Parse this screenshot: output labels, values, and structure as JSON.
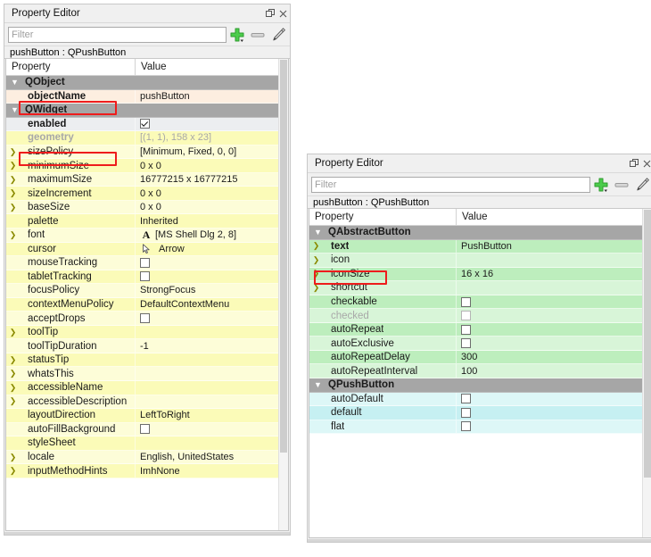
{
  "left_panel": {
    "title": "Property Editor",
    "window_controls": {
      "float_label": "float-icon",
      "close_label": "close-icon"
    },
    "filter": {
      "value": "",
      "placeholder": "Filter"
    },
    "toolbar": {
      "add_label": "add-icon",
      "remove_label": "remove-icon",
      "configure_label": "configure-icon"
    },
    "object_header": "pushButton : QPushButton",
    "columns": {
      "property": "Property",
      "value": "Value"
    },
    "rows": [
      {
        "kind": "group",
        "prop": "QObject",
        "value": "",
        "expander": "v",
        "tint": "group"
      },
      {
        "kind": "prop",
        "prop": "objectName",
        "value": "pushButton",
        "expander": "",
        "tint": "tint-peach",
        "bold": true
      },
      {
        "kind": "group",
        "prop": "QWidget",
        "value": "",
        "expander": "v",
        "tint": "group"
      },
      {
        "kind": "check",
        "prop": "enabled",
        "value": "checked",
        "expander": "",
        "tint": "tint-gray",
        "bold": true
      },
      {
        "kind": "prop",
        "prop": "geometry",
        "value": "[(1, 1), 158 x 23]",
        "expander": "",
        "tint": "tint-yel2",
        "bold": true,
        "disabled": true
      },
      {
        "kind": "prop",
        "prop": "sizePolicy",
        "value": "[Minimum, Fixed, 0, 0]",
        "expander": ">",
        "tint": "tint-yel1"
      },
      {
        "kind": "prop",
        "prop": "minimumSize",
        "value": "0 x 0",
        "expander": ">",
        "tint": "tint-yel2"
      },
      {
        "kind": "prop",
        "prop": "maximumSize",
        "value": "16777215 x 16777215",
        "expander": ">",
        "tint": "tint-yel1"
      },
      {
        "kind": "prop",
        "prop": "sizeIncrement",
        "value": "0 x 0",
        "expander": ">",
        "tint": "tint-yel2"
      },
      {
        "kind": "prop",
        "prop": "baseSize",
        "value": "0 x 0",
        "expander": ">",
        "tint": "tint-yel1"
      },
      {
        "kind": "prop",
        "prop": "palette",
        "value": "Inherited",
        "expander": "",
        "tint": "tint-yel2"
      },
      {
        "kind": "font",
        "prop": "font",
        "value": "[MS Shell Dlg 2, 8]",
        "expander": ">",
        "tint": "tint-yel1"
      },
      {
        "kind": "cursor",
        "prop": "cursor",
        "value": "Arrow",
        "expander": "",
        "tint": "tint-yel2"
      },
      {
        "kind": "check",
        "prop": "mouseTracking",
        "value": "unchecked",
        "expander": "",
        "tint": "tint-yel1"
      },
      {
        "kind": "check",
        "prop": "tabletTracking",
        "value": "unchecked",
        "expander": "",
        "tint": "tint-yel2"
      },
      {
        "kind": "prop",
        "prop": "focusPolicy",
        "value": "StrongFocus",
        "expander": "",
        "tint": "tint-yel1"
      },
      {
        "kind": "prop",
        "prop": "contextMenuPolicy",
        "value": "DefaultContextMenu",
        "expander": "",
        "tint": "tint-yel2"
      },
      {
        "kind": "check",
        "prop": "acceptDrops",
        "value": "unchecked",
        "expander": "",
        "tint": "tint-yel1"
      },
      {
        "kind": "prop",
        "prop": "toolTip",
        "value": "",
        "expander": ">",
        "tint": "tint-yel2"
      },
      {
        "kind": "prop",
        "prop": "toolTipDuration",
        "value": "-1",
        "expander": "",
        "tint": "tint-yel1"
      },
      {
        "kind": "prop",
        "prop": "statusTip",
        "value": "",
        "expander": ">",
        "tint": "tint-yel2"
      },
      {
        "kind": "prop",
        "prop": "whatsThis",
        "value": "",
        "expander": ">",
        "tint": "tint-yel1"
      },
      {
        "kind": "prop",
        "prop": "accessibleName",
        "value": "",
        "expander": ">",
        "tint": "tint-yel2"
      },
      {
        "kind": "prop",
        "prop": "accessibleDescription",
        "value": "",
        "expander": ">",
        "tint": "tint-yel1"
      },
      {
        "kind": "prop",
        "prop": "layoutDirection",
        "value": "LeftToRight",
        "expander": "",
        "tint": "tint-yel2"
      },
      {
        "kind": "check",
        "prop": "autoFillBackground",
        "value": "unchecked",
        "expander": "",
        "tint": "tint-yel1"
      },
      {
        "kind": "prop",
        "prop": "styleSheet",
        "value": "",
        "expander": "",
        "tint": "tint-yel2"
      },
      {
        "kind": "prop",
        "prop": "locale",
        "value": "English, UnitedStates",
        "expander": ">",
        "tint": "tint-yel1"
      },
      {
        "kind": "prop",
        "prop": "inputMethodHints",
        "value": "ImhNone",
        "expander": ">",
        "tint": "tint-yel2"
      }
    ]
  },
  "right_panel": {
    "title": "Property Editor",
    "window_controls": {
      "float_label": "float-icon",
      "close_label": "close-icon"
    },
    "filter": {
      "value": "",
      "placeholder": "Filter"
    },
    "toolbar": {
      "add_label": "add-icon",
      "remove_label": "remove-icon",
      "configure_label": "configure-icon"
    },
    "object_header": "pushButton : QPushButton",
    "columns": {
      "property": "Property",
      "value": "Value"
    },
    "rows": [
      {
        "kind": "group",
        "prop": "QAbstractButton",
        "value": "",
        "expander": "v",
        "tint": "group"
      },
      {
        "kind": "prop",
        "prop": "text",
        "value": "PushButton",
        "expander": ">",
        "tint": "tint-grn2",
        "bold": true
      },
      {
        "kind": "prop",
        "prop": "icon",
        "value": "",
        "expander": ">",
        "tint": "tint-grn1"
      },
      {
        "kind": "prop",
        "prop": "iconSize",
        "value": "16 x 16",
        "expander": ">",
        "tint": "tint-grn2"
      },
      {
        "kind": "prop",
        "prop": "shortcut",
        "value": "",
        "expander": ">",
        "tint": "tint-grn1"
      },
      {
        "kind": "check",
        "prop": "checkable",
        "value": "unchecked",
        "expander": "",
        "tint": "tint-grn2"
      },
      {
        "kind": "check",
        "prop": "checked",
        "value": "unchecked",
        "expander": "",
        "tint": "tint-grn1",
        "disabled": true
      },
      {
        "kind": "check",
        "prop": "autoRepeat",
        "value": "unchecked",
        "expander": "",
        "tint": "tint-grn2"
      },
      {
        "kind": "check",
        "prop": "autoExclusive",
        "value": "unchecked",
        "expander": "",
        "tint": "tint-grn1"
      },
      {
        "kind": "prop",
        "prop": "autoRepeatDelay",
        "value": "300",
        "expander": "",
        "tint": "tint-grn2"
      },
      {
        "kind": "prop",
        "prop": "autoRepeatInterval",
        "value": "100",
        "expander": "",
        "tint": "tint-grn1"
      },
      {
        "kind": "group",
        "prop": "QPushButton",
        "value": "",
        "expander": "v",
        "tint": "group"
      },
      {
        "kind": "check",
        "prop": "autoDefault",
        "value": "unchecked",
        "expander": "",
        "tint": "tint-cyan1"
      },
      {
        "kind": "check",
        "prop": "default",
        "value": "unchecked",
        "expander": "",
        "tint": "tint-cyan2"
      },
      {
        "kind": "check",
        "prop": "flat",
        "value": "unchecked",
        "expander": "",
        "tint": "tint-cyan1"
      }
    ]
  },
  "annotations": [
    {
      "name": "objectName-highlight",
      "target": "objectName"
    },
    {
      "name": "geometry-highlight",
      "target": "geometry"
    },
    {
      "name": "text-highlight",
      "target": "text"
    }
  ],
  "colors": {
    "annotation_red": "#ee1c1c",
    "group_header_gray": "#a6a6a6",
    "qobject_row": "#fdeee0",
    "qwidget_row": "#fbfbb8",
    "qabstractbutton_row": "#bdeebd",
    "qpushbutton_row": "#c6f0f2",
    "add_icon_green": "#3cc23c",
    "panel_bg": "#f0f0f0"
  }
}
